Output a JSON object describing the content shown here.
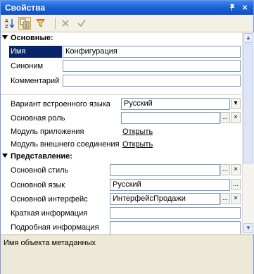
{
  "window": {
    "title": "Свойства",
    "pin_icon": "pin-icon",
    "close_label": "×"
  },
  "toolbar": {
    "sort_icon": "sort-az-icon",
    "categories_icon": "categories-icon",
    "filter_icon": "filter-icon",
    "clear_icon": "clear-x-icon",
    "apply_icon": "check-icon"
  },
  "sections": {
    "main": "Основные:",
    "view": "Представление:"
  },
  "fields": {
    "name_label": "Имя",
    "name_value": "Конфигурация",
    "synonym_label": "Синоним",
    "synonym_value": "",
    "comment_label": "Комментарий",
    "comment_value": "",
    "lang_variant_label": "Вариант встроенного языка",
    "lang_variant_value": "Русский",
    "main_role_label": "Основная роль",
    "main_role_value": "",
    "app_module_label": "Модуль приложения",
    "app_module_link": "Открыть",
    "ext_conn_module_label": "Модуль внешнего соединения",
    "ext_conn_module_link": "Открыть",
    "main_style_label": "Основной стиль",
    "main_style_value": "",
    "main_language_label": "Основной язык",
    "main_language_value": "Русский",
    "main_interface_label": "Основной интерфейс",
    "main_interface_value": "ИнтерфейсПродажи",
    "short_info_label": "Краткая информация",
    "short_info_value": "",
    "detailed_info_label": "Подробная информация",
    "detailed_info_value": ""
  },
  "buttons": {
    "ellipsis": "...",
    "clear": "×",
    "dropdown": "▾"
  },
  "status": {
    "hint": "Имя объекта метаданных"
  }
}
